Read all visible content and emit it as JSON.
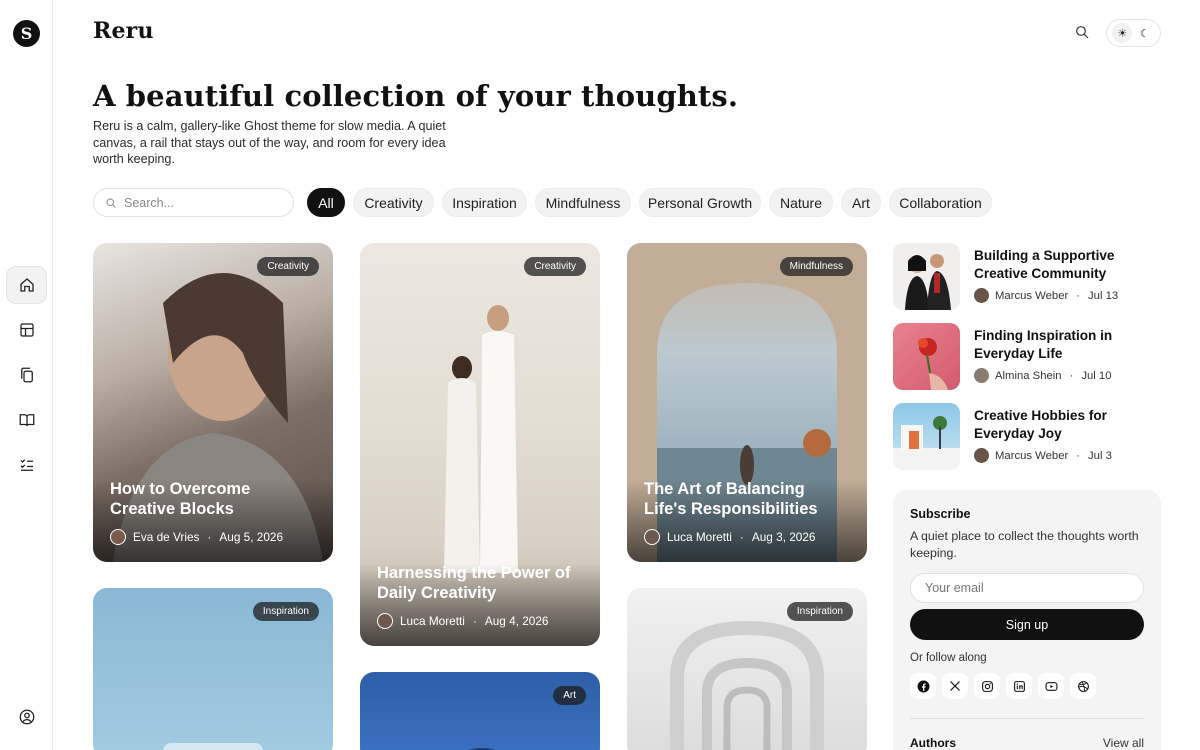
{
  "brand": "Reru",
  "hero": {
    "title": "A beautiful collection of your thoughts.",
    "description": "Reru is a calm, gallery-like Ghost theme for slow media. A quiet canvas, a rail that stays out of the way, and room for every idea worth keeping."
  },
  "search": {
    "placeholder": "Search..."
  },
  "tags": [
    "All",
    "Creativity",
    "Inspiration",
    "Mindfulness",
    "Personal Growth",
    "Nature",
    "Art",
    "Collaboration"
  ],
  "posts": [
    {
      "tag": "Creativity",
      "title": "How to Overcome Creative Blocks",
      "author": "Eva de Vries",
      "date": "Aug 5, 2026"
    },
    {
      "tag": "Creativity",
      "title": "Harnessing the Power of Daily Creativity",
      "author": "Luca Moretti",
      "date": "Aug 4, 2026"
    },
    {
      "tag": "Mindfulness",
      "title": "The Art of Balancing Life's Responsibilities",
      "author": "Luca Moretti",
      "date": "Aug 3, 2026"
    },
    {
      "tag": "Inspiration"
    },
    {
      "tag": "Art"
    },
    {
      "tag": "Inspiration"
    }
  ],
  "side_posts": [
    {
      "title": "Building a Supportive Creative Community",
      "author": "Marcus Weber",
      "date": "Jul 13"
    },
    {
      "title": "Finding Inspiration in Everyday Life",
      "author": "Almina Shein",
      "date": "Jul 10"
    },
    {
      "title": "Creative Hobbies for Everyday Joy",
      "author": "Marcus Weber",
      "date": "Jul 3"
    }
  ],
  "subscribe": {
    "heading": "Subscribe",
    "description": "A quiet place to collect the thoughts worth keeping.",
    "email_placeholder": "Your email",
    "button": "Sign up",
    "follow_label": "Or follow along",
    "socials": [
      "facebook-icon",
      "x-icon",
      "instagram-icon",
      "linkedin-icon",
      "youtube-icon",
      "dribbble-icon"
    ]
  },
  "authors": {
    "heading": "Authors",
    "view_all": "View all"
  },
  "icons": {
    "logo": "S",
    "rail": [
      "home-icon",
      "layout-icon",
      "copy-icon",
      "book-icon",
      "checklist-icon",
      "account-icon"
    ]
  }
}
